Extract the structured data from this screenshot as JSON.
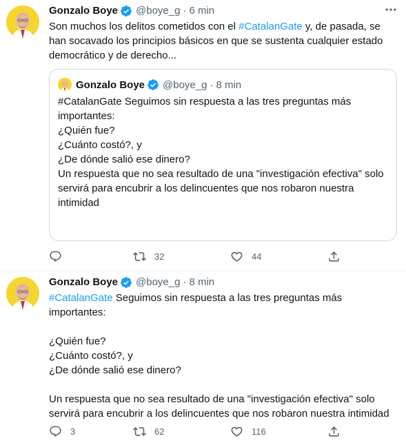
{
  "tweets": [
    {
      "name": "Gonzalo Boye",
      "handle": "@boye_g",
      "separator": "·",
      "time": "6 min",
      "text_lines": [
        {
          "pre": "Son muchos los delitos cometidos con el ",
          "tag": "#CatalanGate",
          "post": " y, de pasada, se"
        },
        {
          "pre": "han socavado los principios básicos en que se sustenta cualquier estado",
          "tag": "",
          "post": ""
        },
        {
          "pre": "democrático y de derecho...",
          "tag": "",
          "post": ""
        }
      ],
      "quote": {
        "name": "Gonzalo Boye",
        "handle": "@boye_g",
        "separator": "·",
        "time": "8 min",
        "lines": [
          "#CatalanGate Seguimos sin respuesta a las tres preguntas más",
          "importantes:",
          "",
          "¿Quién fue?",
          "¿Cuánto costó?, y",
          "¿De dónde salió ese dinero?",
          "",
          "Un respuesta que no sea resultado de una \"investigación efectiva\" solo",
          "servirá para encubrir a los delincuentes que nos robaron nuestra",
          "intimidad"
        ]
      },
      "reply_count": "",
      "retweet_count": "32",
      "like_count": "44"
    },
    {
      "name": "Gonzalo Boye",
      "handle": "@boye_g",
      "separator": "·",
      "time": "8 min",
      "first_line": {
        "tag": "#CatalanGate",
        "post": " Seguimos sin respuesta a las tres preguntas más"
      },
      "lines": [
        "importantes:",
        "",
        "¿Quién fue?",
        "¿Cuánto costó?, y",
        "¿De dónde salió ese dinero?",
        "",
        "Un respuesta que no sea resultado de una \"investigación efectiva\" solo",
        "servirá para encubrir a los delincuentes que nos robaron nuestra intimidad"
      ],
      "reply_count": "3",
      "retweet_count": "62",
      "like_count": "116"
    }
  ],
  "colors": {
    "accent": "#1d9bf0",
    "secondary_text": "#536471",
    "border": "#cfd9de"
  },
  "icons": [
    "verified-badge-icon",
    "more-icon",
    "reply-icon",
    "retweet-icon",
    "like-icon",
    "share-icon"
  ]
}
